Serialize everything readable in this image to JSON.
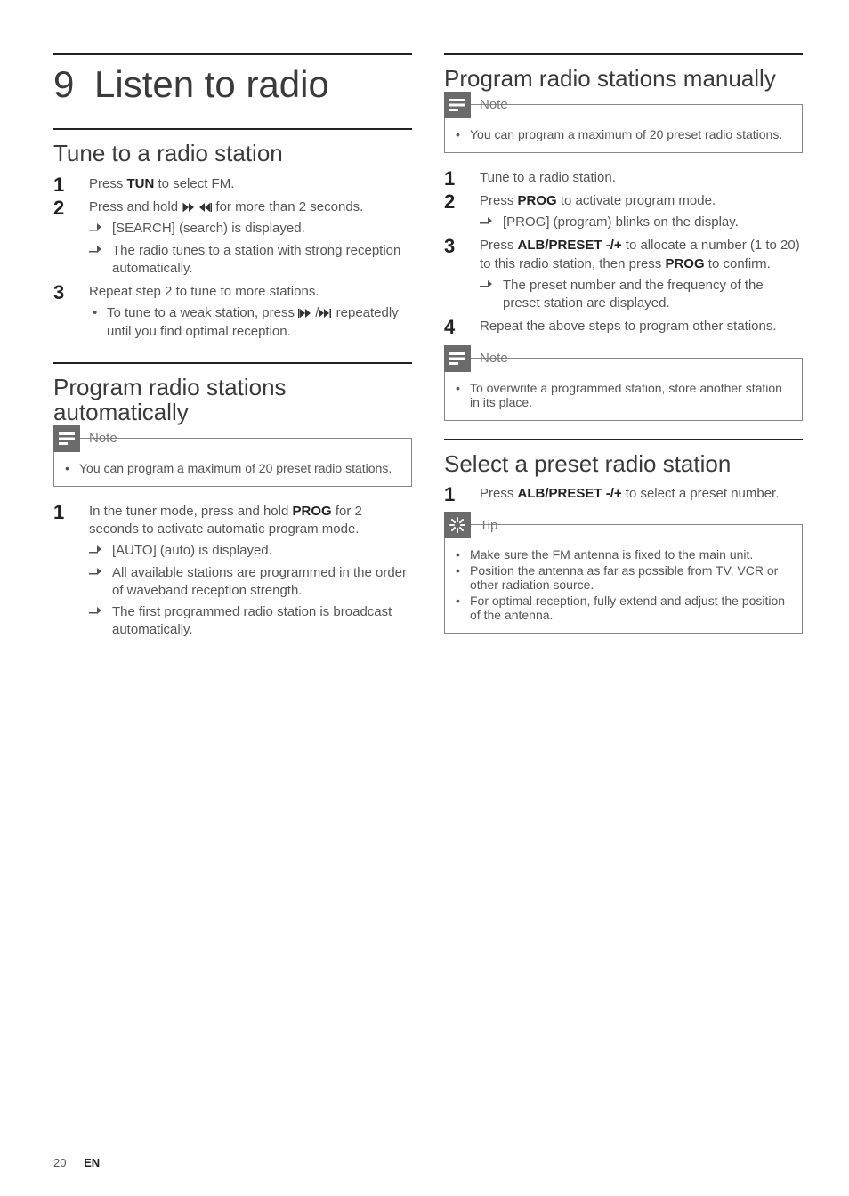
{
  "chapter": {
    "number": "9",
    "title": "Listen to radio"
  },
  "left": {
    "section1": {
      "heading": "Tune to a radio station",
      "steps": {
        "s1": {
          "pre": "Press ",
          "key": "TUN",
          "post": " to select FM."
        },
        "s2": {
          "pre": "Press and hold ",
          "post": " for more than 2 seconds.",
          "r1": "[SEARCH] (search) is displayed.",
          "r2": "The radio tunes to a station with strong reception automatically."
        },
        "s3": {
          "text": "Repeat step 2 to tune to more stations.",
          "b1a": "To tune to a weak station, press ",
          "b1b": " repeatedly until you find optimal reception."
        }
      }
    },
    "section2": {
      "heading": "Program radio stations automatically",
      "note": {
        "title": "Note",
        "item": "You can program a maximum of 20 preset radio stations."
      },
      "steps": {
        "s1": {
          "pre": "In the tuner mode, press and hold ",
          "key": "PROG",
          "post": " for 2 seconds to activate automatic program mode.",
          "r1": "[AUTO] (auto) is displayed.",
          "r2": "All available stations are programmed in the order of waveband reception strength.",
          "r3": "The first programmed radio station is broadcast automatically."
        }
      }
    }
  },
  "right": {
    "section1": {
      "heading": "Program radio stations manually",
      "note1": {
        "title": "Note",
        "item": "You can program a maximum of 20 preset radio stations."
      },
      "steps": {
        "s1": "Tune to a radio station.",
        "s2": {
          "pre": "Press ",
          "key": "PROG",
          "post": " to activate program mode.",
          "r1": "[PROG] (program) blinks on the display."
        },
        "s3": {
          "pre": "Press ",
          "key1": "ALB/PRESET -/+",
          "mid": " to allocate a number (1 to 20) to this radio station, then press ",
          "key2": "PROG",
          "post": " to confirm.",
          "r1": "The preset number and the frequency of the preset station are displayed."
        },
        "s4": "Repeat the above steps to program other stations."
      },
      "note2": {
        "title": "Note",
        "item": "To overwrite a programmed station, store another station in its place."
      }
    },
    "section2": {
      "heading": "Select a preset radio station",
      "steps": {
        "s1": {
          "pre": "Press ",
          "key": "ALB/PRESET -/+",
          "post": " to select a preset number."
        }
      },
      "tip": {
        "title": "Tip",
        "i1": "Make sure the FM antenna is fixed to the main unit.",
        "i2": "Position the antenna as far as possible from TV, VCR or other radiation source.",
        "i3": "For optimal reception, fully extend and adjust the position of the antenna."
      }
    }
  },
  "footer": {
    "page": "20",
    "lang": "EN"
  }
}
